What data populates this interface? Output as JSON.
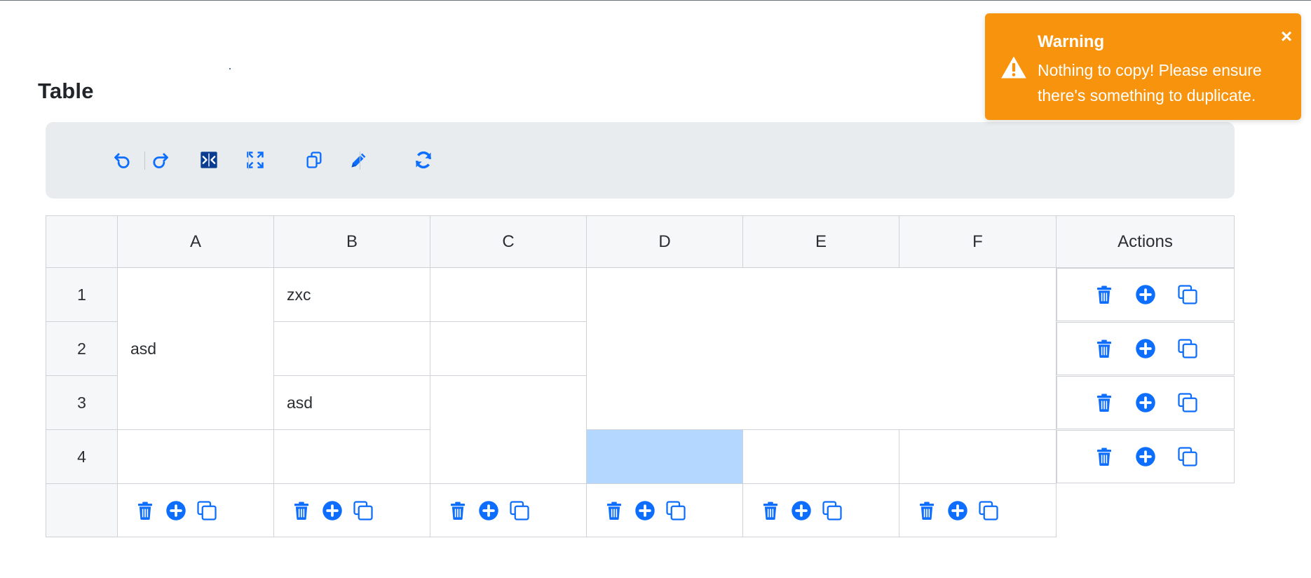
{
  "page": {
    "title": "Table"
  },
  "colors": {
    "accent": "#0d6efd",
    "toast_bg": "#f7930c",
    "selected_cell": "#b3d7ff",
    "toolbar_bg": "#e9ecef"
  },
  "toolbar": {
    "buttons": [
      {
        "name": "undo-icon"
      },
      {
        "name": "redo-icon"
      },
      {
        "name": "merge-cells-icon"
      },
      {
        "name": "expand-icon"
      },
      {
        "name": "copy-icon"
      },
      {
        "name": "pencil-icon"
      },
      {
        "name": "refresh-icon"
      }
    ]
  },
  "table": {
    "columns": [
      "A",
      "B",
      "C",
      "D",
      "E",
      "F"
    ],
    "actions_header": "Actions",
    "rows": [
      "1",
      "2",
      "3",
      "4"
    ],
    "cells": {
      "A1": "asd",
      "B1": "zxc",
      "B3": "asd"
    },
    "row_action_icons": [
      "trash-icon",
      "plus-circle-icon",
      "duplicate-icon"
    ],
    "col_action_icons": [
      "trash-icon",
      "plus-circle-icon",
      "duplicate-icon"
    ]
  },
  "toast": {
    "title": "Warning",
    "message": "Nothing to copy! Please ensure there's something to duplicate.",
    "close": "×"
  }
}
